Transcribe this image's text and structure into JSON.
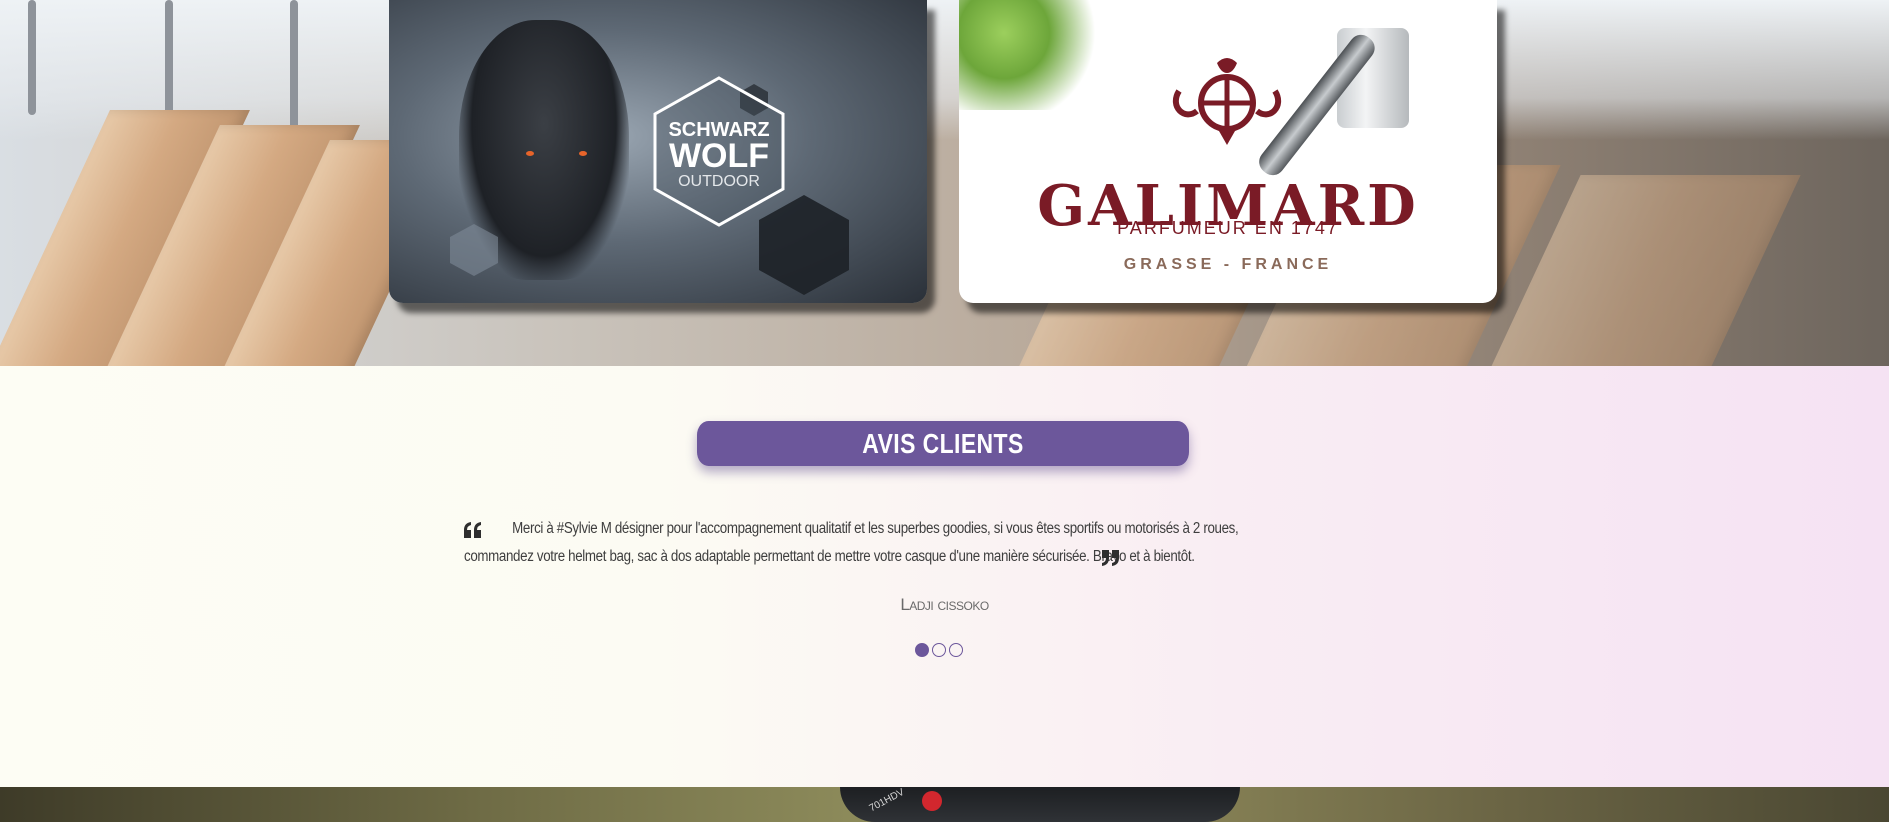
{
  "brands": {
    "wolf": {
      "logo_line1": "SCHWARZ",
      "logo_line2": "WOLF",
      "logo_line3": "OUTDOOR"
    },
    "galimard": {
      "name": "GALIMARD",
      "tagline": "PARFUMEUR EN 1747",
      "location": "GRASSE - FRANCE"
    }
  },
  "reviews": {
    "title": "AVIS CLIENTS",
    "quote_open_icon": "quote-open-icon",
    "quote_close_icon": "quote-close-icon",
    "testimonial": "Merci à #Sylvie M désigner pour l'accompagnement qualitatif et les superbes goodies, si vous êtes sportifs ou motorisés à 2 roues, commandez votre helmet bag, sac à dos adaptable permettant de mettre votre casque d'une manière sécurisée. Bravo et à bientôt.",
    "author": "Ladji cissoko",
    "pagination": {
      "total": 3,
      "active": 1
    }
  },
  "footer_image": {
    "device_label": "701HDV"
  },
  "colors": {
    "accent": "#6c579b",
    "galimard_red": "#7a1b26",
    "text": "#3e3e3e"
  }
}
